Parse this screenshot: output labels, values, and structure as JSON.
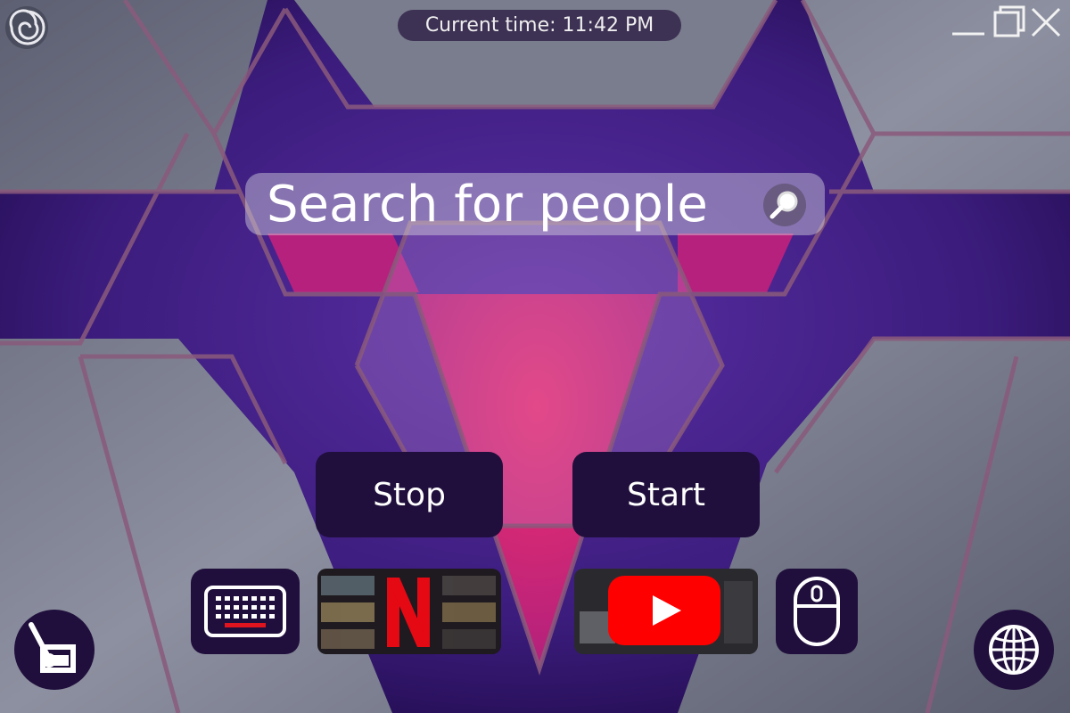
{
  "header": {
    "time_label": "Current time: 11:42 PM"
  },
  "window_controls": [
    "minimize-icon",
    "maximize-icon",
    "close-icon"
  ],
  "search": {
    "text": "Search for people",
    "icon": "magnifier-icon"
  },
  "buttons": {
    "stop": "Stop",
    "start": "Start"
  },
  "dock": {
    "items": [
      "keyboard-icon",
      "netflix-thumbnail",
      "youtube-thumbnail",
      "mouse-icon"
    ]
  },
  "corner": {
    "left": "paint-brush-canvas-icon",
    "right": "globe-icon"
  },
  "colors": {
    "panel": "#200f3c",
    "accent_pink": "#e02a6e",
    "purple": "#4a2590",
    "metal": "#7c7f8e",
    "netflix_red": "#e50914",
    "youtube_red": "#ff0000"
  }
}
